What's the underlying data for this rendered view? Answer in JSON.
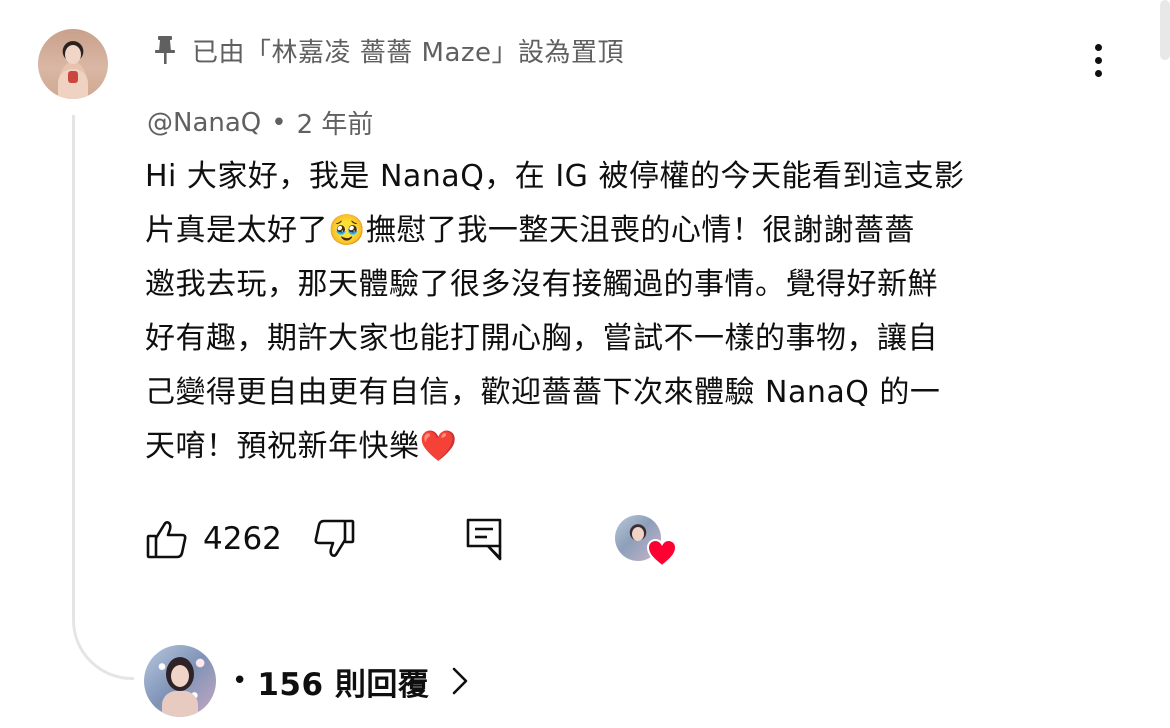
{
  "pinned": {
    "icon": "pin-icon",
    "label": "已由「林嘉凌 薔薔 Maze」設為置頂"
  },
  "comment": {
    "author": "@NanaQ",
    "separator": "•",
    "time": "2 年前",
    "text": "Hi 大家好，我是 NanaQ，在 IG 被停權的今天能看到這支影\n片真是太好了🥹撫慰了我一整天沮喪的心情！很謝謝薔薔\n邀我去玩，那天體驗了很多沒有接觸過的事情。覺得好新鮮\n好有趣，期許大家也能打開心胸，嘗試不一樣的事物，讓自\n己變得更自由更有自信，歡迎薔薔下次來體驗 NanaQ 的一\n天唷！預祝新年快樂❤️"
  },
  "actions": {
    "like_icon": "thumbs-up-icon",
    "like_count": "4262",
    "dislike_icon": "thumbs-down-icon",
    "reply_icon": "reply-comment-icon",
    "creator_heart_icon": "heart-icon"
  },
  "replies": {
    "bullet": "•",
    "count_label": "156 則回覆",
    "chevron_icon": "chevron-right-icon"
  },
  "colors": {
    "text_primary": "#0f0f0f",
    "text_secondary": "#606060",
    "heart": "#ff0033",
    "thread_line": "#e5e5e5"
  }
}
